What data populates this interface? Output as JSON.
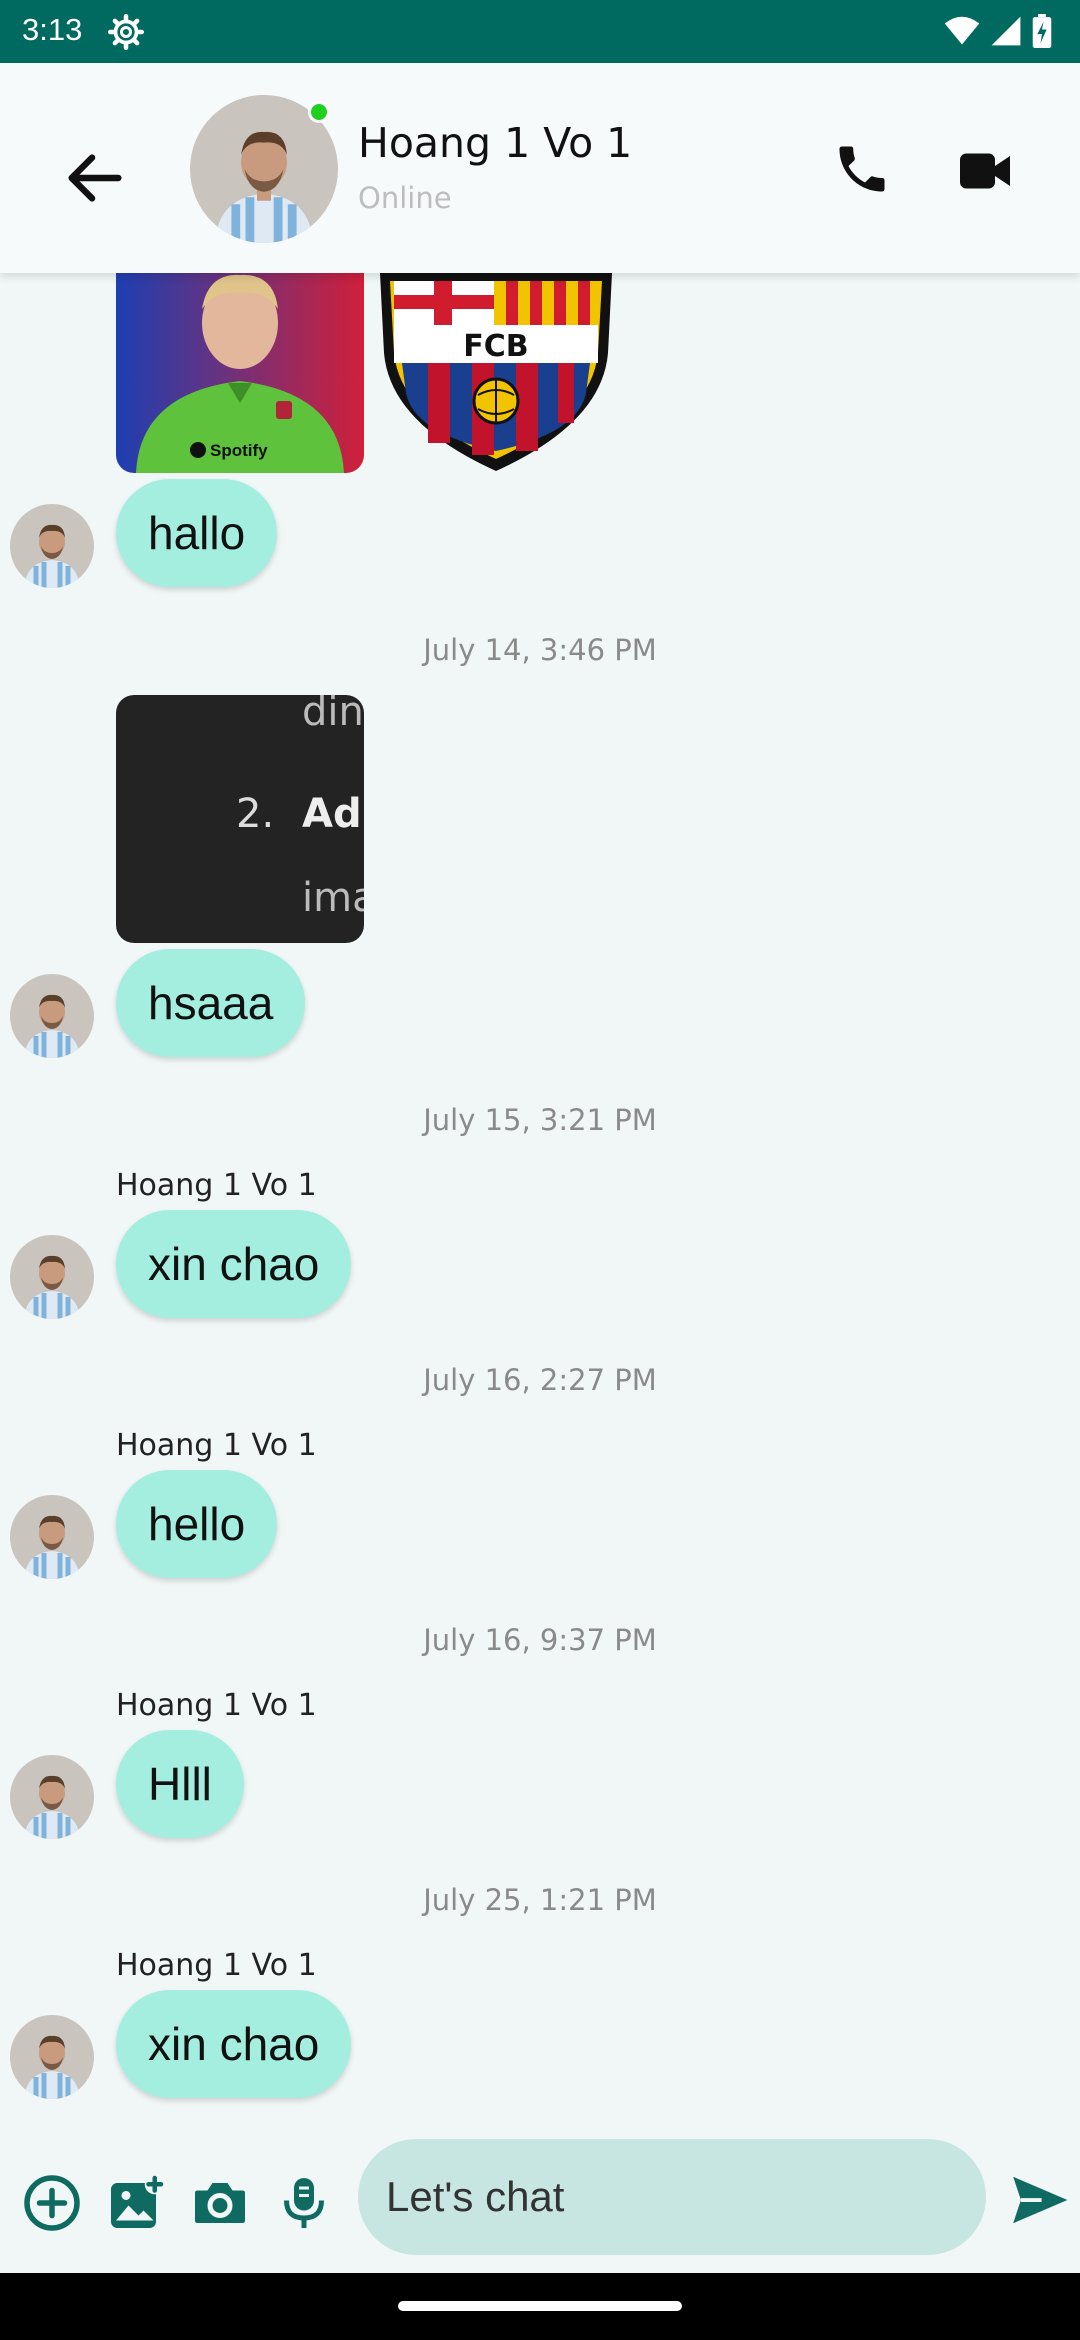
{
  "status_bar": {
    "time": "3:13"
  },
  "header": {
    "contact_name": "Hoang 1 Vo 1",
    "contact_status": "Online"
  },
  "messages": [
    {
      "text": "hallo"
    },
    {
      "timestamp": "July 14, 3:46 PM",
      "image_lines": [
        "din",
        "2.",
        "Ad",
        "ima"
      ],
      "text": "hsaaa"
    },
    {
      "timestamp": "July 15, 3:21 PM",
      "sender": "Hoang 1 Vo 1",
      "text": "xin chao"
    },
    {
      "timestamp": "July 16, 2:27 PM",
      "sender": "Hoang 1 Vo 1",
      "text": "hello"
    },
    {
      "timestamp": "July 16, 9:37 PM",
      "sender": "Hoang 1 Vo 1",
      "text": "Hlll"
    },
    {
      "timestamp": "July 25, 1:21 PM",
      "sender": "Hoang 1 Vo 1",
      "text": "xin chao"
    }
  ],
  "sticker": {
    "fcb_text": "FCB",
    "shirt_text": "Spotify"
  },
  "composer": {
    "placeholder": "Let's chat"
  },
  "colors": {
    "status_bar": "#006a60",
    "bubble": "#a4eee0",
    "accent": "#0f6b62",
    "input": "#c8e6e1"
  }
}
